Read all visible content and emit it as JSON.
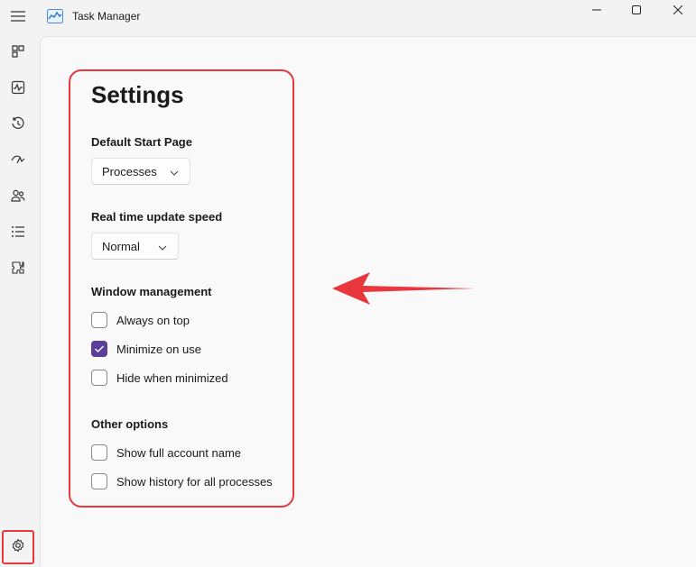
{
  "window": {
    "title": "Task Manager"
  },
  "icons": {
    "menu": "hamburger-menu-icon",
    "app": "task-manager-app-icon",
    "nav": [
      "processes-icon",
      "performance-icon",
      "app-history-icon",
      "startup-apps-icon",
      "users-icon",
      "details-icon",
      "services-icon"
    ],
    "settings": "gear-icon"
  },
  "settings": {
    "title": "Settings",
    "default_start_page": {
      "label": "Default Start Page",
      "value": "Processes"
    },
    "update_speed": {
      "label": "Real time update speed",
      "value": "Normal"
    },
    "window_management": {
      "label": "Window management",
      "options": [
        {
          "label": "Always on top",
          "checked": false
        },
        {
          "label": "Minimize on use",
          "checked": true
        },
        {
          "label": "Hide when minimized",
          "checked": false
        }
      ]
    },
    "other_options": {
      "label": "Other options",
      "options": [
        {
          "label": "Show full account name",
          "checked": false
        },
        {
          "label": "Show history for all processes",
          "checked": false
        }
      ]
    }
  },
  "colors": {
    "accent": "#5a3e9a",
    "annotation": "#e8383d"
  }
}
